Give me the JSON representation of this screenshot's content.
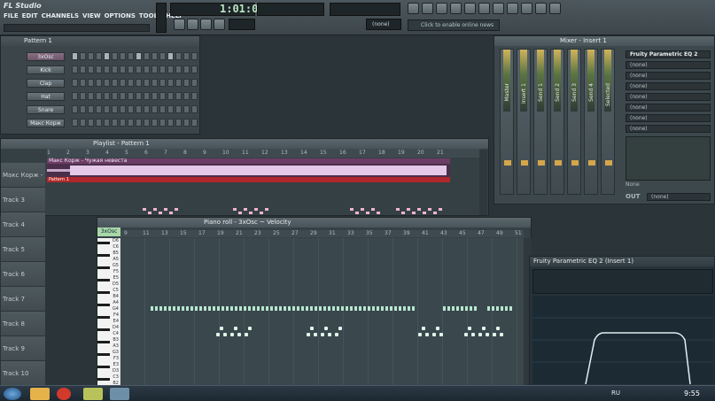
{
  "app": {
    "logo": "FL Studio",
    "menu": [
      "FILE",
      "EDIT",
      "CHANNELS",
      "VIEW",
      "OPTIONS",
      "TOOLS",
      "HELP"
    ],
    "time": "1:01:000",
    "news": "Click to enable online news",
    "none_label": "(none)"
  },
  "channel_rack": {
    "title": "Pattern 1",
    "channels": [
      {
        "name": "3xOsc",
        "steps": [
          1,
          0,
          0,
          0,
          1,
          0,
          0,
          0,
          1,
          0,
          0,
          0,
          1,
          0,
          0,
          0
        ]
      },
      {
        "name": "Kick",
        "steps": [
          0,
          0,
          0,
          0,
          0,
          0,
          0,
          0,
          0,
          0,
          0,
          0,
          0,
          0,
          0,
          0
        ]
      },
      {
        "name": "Clap",
        "steps": [
          0,
          0,
          0,
          0,
          0,
          0,
          0,
          0,
          0,
          0,
          0,
          0,
          0,
          0,
          0,
          0
        ]
      },
      {
        "name": "Hat",
        "steps": [
          0,
          0,
          0,
          0,
          0,
          0,
          0,
          0,
          0,
          0,
          0,
          0,
          0,
          0,
          0,
          0
        ]
      },
      {
        "name": "Snare",
        "steps": [
          0,
          0,
          0,
          0,
          0,
          0,
          0,
          0,
          0,
          0,
          0,
          0,
          0,
          0,
          0,
          0
        ]
      },
      {
        "name": "Макс Корж",
        "steps": [
          0,
          0,
          0,
          0,
          0,
          0,
          0,
          0,
          0,
          0,
          0,
          0,
          0,
          0,
          0,
          0
        ]
      }
    ]
  },
  "playlist": {
    "title": "Playlist - Pattern 1",
    "audio_clip": "Макс Корж - Чужая невеста",
    "pattern_clip": "Pattern 1",
    "tracks": [
      "Макс Корж - Чу",
      "Track 3",
      "Track 4",
      "Track 5",
      "Track 6",
      "Track 7",
      "Track 8",
      "Track 9",
      "Track 10"
    ],
    "ruler": [
      "1",
      "2",
      "3",
      "4",
      "5",
      "6",
      "7",
      "8",
      "9",
      "10",
      "11",
      "12",
      "13",
      "14",
      "15",
      "16",
      "17",
      "18",
      "19",
      "20",
      "21"
    ]
  },
  "piano_roll": {
    "title": "Piano roll - 3xOsc",
    "mode": "Velocity",
    "channel": "3xOsc",
    "ruler": [
      "9",
      "11",
      "13",
      "15",
      "17",
      "19",
      "21",
      "23",
      "25",
      "27",
      "29",
      "31",
      "33",
      "35",
      "37",
      "39",
      "41",
      "43",
      "45",
      "47",
      "49",
      "51"
    ],
    "keys": [
      "D6",
      "C6",
      "B5",
      "A5",
      "G5",
      "F5",
      "E5",
      "D5",
      "C5",
      "B4",
      "A4",
      "G4",
      "F4",
      "E4",
      "D4",
      "C4",
      "B3",
      "A3",
      "G3",
      "F3",
      "E3",
      "D3",
      "C3",
      "B2",
      "A2",
      "G2"
    ]
  },
  "mixer": {
    "title": "Mixer - Insert 1",
    "strips": [
      "Master",
      "Insert 1",
      "Send 1",
      "Send 2",
      "Send 3",
      "Send 4",
      "Selected"
    ],
    "effect_slot_1": "Fruity Parametric EQ 2",
    "slots": [
      "(none)",
      "(none)",
      "(none)",
      "(none)",
      "(none)",
      "(none)",
      "(none)"
    ],
    "out_label": "OUT",
    "none_label": "None"
  },
  "eq": {
    "title": "Fruity Parametric EQ 2 (Insert 1)"
  },
  "taskbar": {
    "lang": "RU",
    "clock": "9:55"
  },
  "colors": {
    "accent": "#c8b3d0",
    "pattern": "#c0392b",
    "notes": "#b7e7cf"
  }
}
